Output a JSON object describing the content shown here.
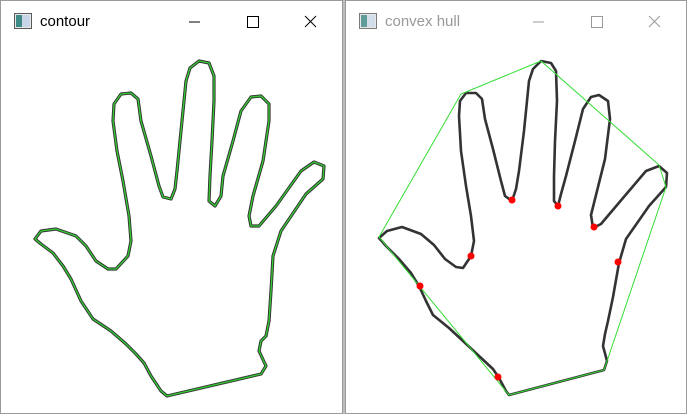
{
  "windows": [
    {
      "title": "contour",
      "icon": "image-window-icon",
      "controls": [
        "minimize",
        "maximize",
        "close"
      ],
      "active": true
    },
    {
      "title": "convex hull",
      "icon": "image-window-icon",
      "controls": [
        "minimize",
        "maximize",
        "close"
      ],
      "active": false
    }
  ],
  "colors": {
    "contour_green": "#33cc33",
    "outline_dark": "#333333",
    "hull_green": "#33dd33",
    "defect_red": "#ff0000",
    "inactive_title": "#999999"
  },
  "convexity_defect_count": 7
}
